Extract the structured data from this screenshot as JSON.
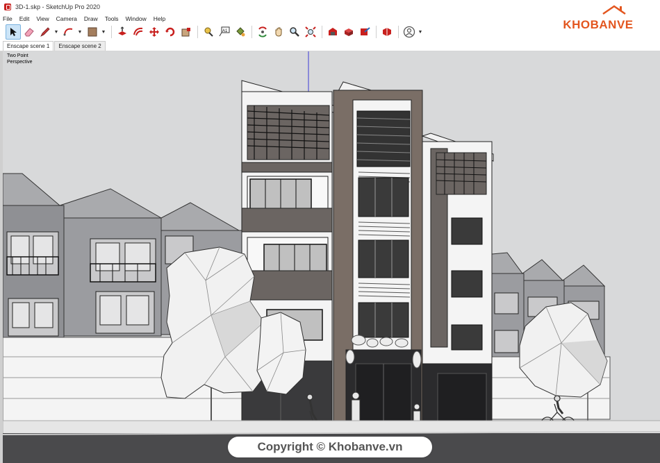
{
  "window": {
    "title": "3D-1.skp - SketchUp Pro 2020"
  },
  "menu": [
    "File",
    "Edit",
    "View",
    "Camera",
    "Draw",
    "Tools",
    "Window",
    "Help"
  ],
  "toolbar": {
    "tools": [
      {
        "name": "select-tool",
        "icon": "arrow-cursor-icon"
      },
      {
        "name": "eraser-tool",
        "icon": "eraser-icon"
      },
      {
        "name": "line-tool",
        "icon": "pencil-icon"
      },
      {
        "name": "arc-tool",
        "icon": "arc-icon"
      },
      {
        "name": "shape-tool",
        "icon": "rectangle-icon"
      },
      {
        "name": "push-pull-tool",
        "icon": "push-pull-icon"
      },
      {
        "name": "offset-tool",
        "icon": "offset-icon"
      },
      {
        "name": "move-tool",
        "icon": "move-icon"
      },
      {
        "name": "rotate-tool",
        "icon": "rotate-icon"
      },
      {
        "name": "scale-tool",
        "icon": "scale-icon"
      },
      {
        "name": "tape-measure-tool",
        "icon": "tape-measure-icon"
      },
      {
        "name": "text-tool",
        "icon": "text-icon"
      },
      {
        "name": "paint-bucket-tool",
        "icon": "paint-bucket-icon"
      },
      {
        "name": "orbit-tool",
        "icon": "orbit-icon"
      },
      {
        "name": "pan-tool",
        "icon": "hand-icon"
      },
      {
        "name": "zoom-tool",
        "icon": "magnifier-icon"
      },
      {
        "name": "zoom-extents-tool",
        "icon": "zoom-extents-icon"
      },
      {
        "name": "warehouse-tool",
        "icon": "warehouse-icon"
      },
      {
        "name": "components-tool",
        "icon": "components-icon"
      },
      {
        "name": "share-model-tool",
        "icon": "share-icon"
      },
      {
        "name": "extension-warehouse-tool",
        "icon": "extension-icon"
      },
      {
        "name": "account-menu",
        "icon": "user-icon"
      }
    ]
  },
  "brand": {
    "logo_text": "KHOBANVE",
    "accent": "#e3561f"
  },
  "scenes": {
    "tabs": [
      "Enscape scene 1",
      "Enscape scene 2"
    ],
    "active": 0
  },
  "viewport": {
    "camera_line1": "Two Point",
    "camera_line2": "Perspective",
    "sky_color": "#d8d9da",
    "axis_blue": "#3b3bd6"
  },
  "watermark": {
    "text": "Copyright © Khobanve.vn"
  }
}
